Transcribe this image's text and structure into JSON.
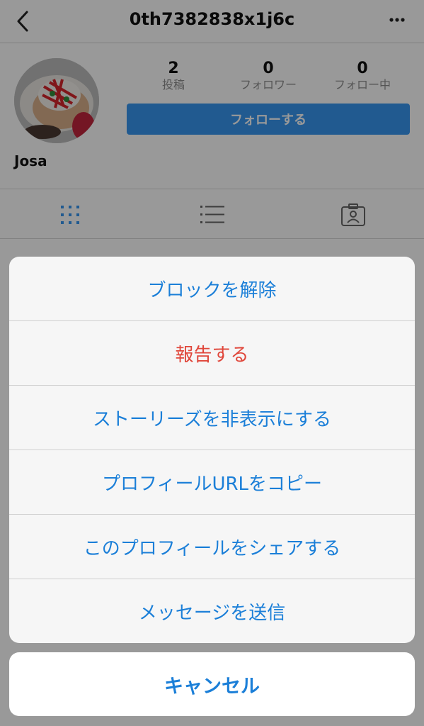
{
  "header": {
    "title": "0th7382838x1j6c",
    "back_icon": "chevron-left-icon",
    "more_icon": "more-horizontal-icon"
  },
  "profile": {
    "username": "Josa",
    "stats": [
      {
        "value": "2",
        "label": "投稿"
      },
      {
        "value": "0",
        "label": "フォロワー"
      },
      {
        "value": "0",
        "label": "フォロー中"
      }
    ],
    "follow_label": "フォローする",
    "follow_color": "#3897f0"
  },
  "tabs": [
    {
      "icon": "grid-icon",
      "active": true
    },
    {
      "icon": "list-icon",
      "active": false
    },
    {
      "icon": "tagged-icon",
      "active": false
    }
  ],
  "action_sheet": {
    "items": [
      {
        "label": "ブロックを解除"
      },
      {
        "label": "報告する",
        "destructive": true
      },
      {
        "label": "ストーリーズを非表示にする"
      },
      {
        "label": "プロフィールURLをコピー"
      },
      {
        "label": "このプロフィールをシェアする"
      },
      {
        "label": "メッセージを送信"
      }
    ],
    "cancel_label": "キャンセル",
    "accent_color": "#1b7fd8",
    "destructive_color": "#e0463a"
  }
}
